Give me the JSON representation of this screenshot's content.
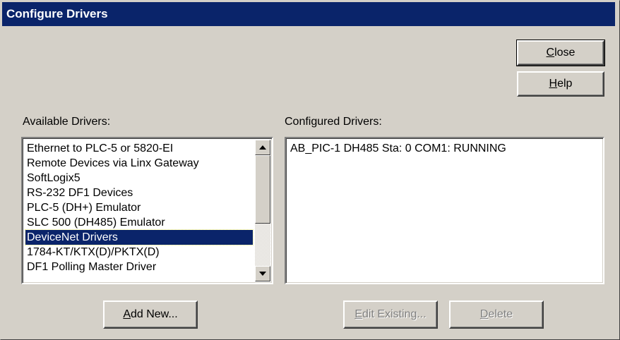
{
  "window": {
    "title": "Configure Drivers"
  },
  "buttons": {
    "close": {
      "mnemonic": "C",
      "rest": "lose"
    },
    "help": {
      "mnemonic": "H",
      "rest": "elp"
    },
    "add_new": {
      "mnemonic": "A",
      "rest": "dd New..."
    },
    "edit_existing": {
      "mnemonic": "E",
      "rest": "dit Existing...",
      "enabled": false
    },
    "delete": {
      "mnemonic": "D",
      "rest": "elete",
      "enabled": false
    }
  },
  "available": {
    "label": "Available Drivers:",
    "items": [
      "Ethernet to PLC-5 or 5820-EI",
      "Remote Devices via Linx Gateway",
      "SoftLogix5",
      "RS-232 DF1 Devices",
      "PLC-5 (DH+) Emulator",
      "SLC 500 (DH485) Emulator",
      "DeviceNet Drivers",
      "1784-KT/KTX(D)/PKTX(D)",
      "DF1 Polling Master Driver"
    ],
    "selected_index": 6
  },
  "configured": {
    "label": "Configured Drivers:",
    "items": [
      "AB_PIC-1 DH485 Sta: 0 COM1: RUNNING"
    ]
  },
  "colors": {
    "title_bar": "#0a246a",
    "face": "#d4d0c8",
    "selection": "#0a246a"
  },
  "icons": {
    "scroll_up": "triangle-up",
    "scroll_down": "triangle-down"
  }
}
